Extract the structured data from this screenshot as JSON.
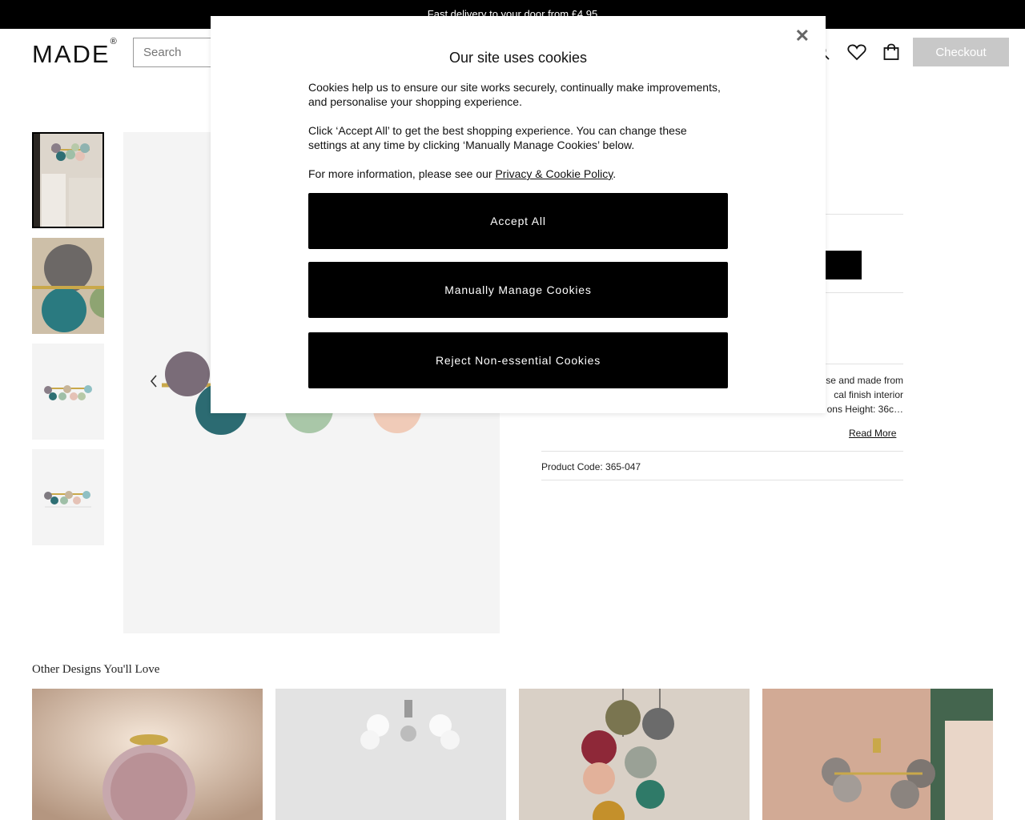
{
  "topbar": {
    "text": "Fast delivery to your door from £4.95"
  },
  "header": {
    "logo": "MADE",
    "logo_mark": "®",
    "search_placeholder": "Search",
    "checkout_label": "Checkout"
  },
  "icons": {
    "search": "search-icon",
    "wishlist": "heart-icon",
    "bag": "bag-icon",
    "close": "close-icon",
    "prev": "chevron-left-icon"
  },
  "product": {
    "description_lines": [
      "se and made from",
      "cal finish interior",
      "ons Height: 36c…"
    ],
    "read_more": "Read More",
    "code": "Product Code: 365-047"
  },
  "recommendations": {
    "title": "Other Designs You'll Love"
  },
  "cookie_modal": {
    "title": "Our site uses cookies",
    "para1": "Cookies help us to ensure our site works securely, continually make improvements, and personalise your shopping experience.",
    "para2": "Click ‘Accept All’ to get the best shopping experience. You can change these settings at any time by clicking ‘Manually Manage Cookies’ below.",
    "para3_prefix": "For more information, please see our ",
    "para3_link": "Privacy & Cookie Policy",
    "para3_suffix": ".",
    "accept_label": "Accept All",
    "manage_label": "Manually Manage Cookies",
    "reject_label": "Reject Non-essential Cookies",
    "close_symbol": "✕"
  },
  "colors": {
    "topbar_bg": "#000000",
    "button_bg": "#000000",
    "checkout_bg": "#c8c8c8",
    "image_bg": "#f4f4f4"
  }
}
